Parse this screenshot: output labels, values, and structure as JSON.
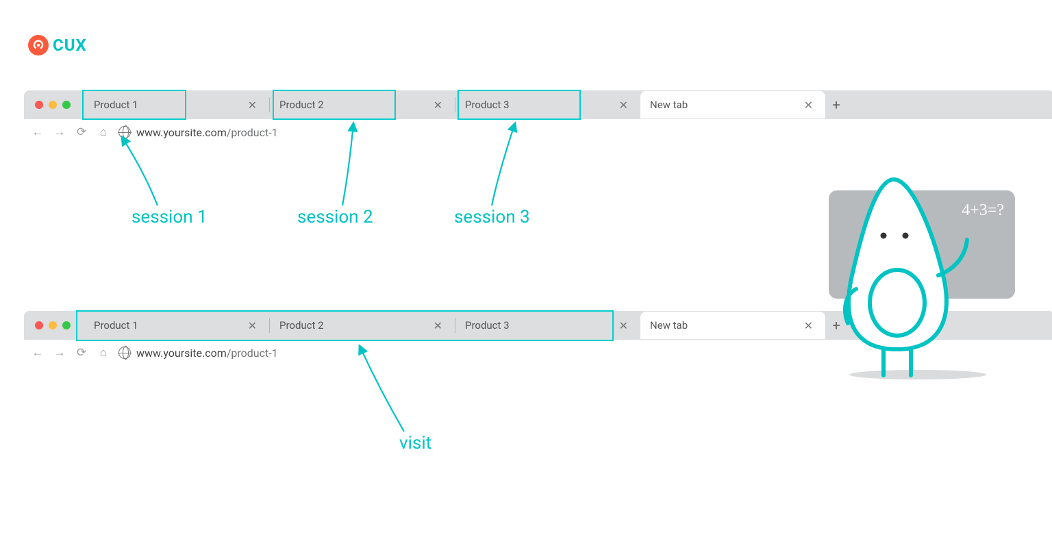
{
  "logo": {
    "text": "CUX"
  },
  "colors": {
    "accent": "#00c3c3",
    "highlight": "#00cfcf",
    "logo_dot": "#ff5a3c"
  },
  "annotations": {
    "session1": "session 1",
    "session2": "session 2",
    "session3": "session 3",
    "visit": "visit"
  },
  "chalkboard": {
    "equation": "4+3=?"
  },
  "browser1": {
    "tabs": [
      {
        "label": "Product 1"
      },
      {
        "label": "Product 2"
      },
      {
        "label": "Product 3"
      },
      {
        "label": "New tab",
        "active": true
      }
    ],
    "url_host": "www.yoursite.com",
    "url_path": "/product-1"
  },
  "browser2": {
    "tabs": [
      {
        "label": "Product 1"
      },
      {
        "label": "Product 2"
      },
      {
        "label": "Product 3"
      },
      {
        "label": "New tab",
        "active": true
      }
    ],
    "url_host": "www.yoursite.com",
    "url_path": "/product-1"
  }
}
